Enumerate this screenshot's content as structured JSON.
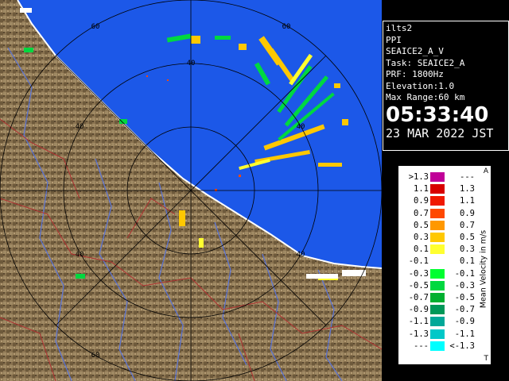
{
  "info": {
    "site": "ilts2",
    "mode": "PPI",
    "product": "SEAICE2_A_V",
    "task": "Task: SEAICE2_A",
    "prf": "PRF: 1800Hz",
    "elevation": "Elevation:1.0",
    "max_range": "Max Range:60 km",
    "time": "05:33:40",
    "date": "23 MAR 2022 JST"
  },
  "map": {
    "range_ring_labels": [
      "60",
      "40",
      "60",
      "40",
      "40",
      "40",
      "40",
      "60"
    ],
    "colors": {
      "sea": "#1c58e8",
      "land": "#8a7350",
      "ring": "#000000",
      "river": "#5a74d8",
      "border": "#b03030",
      "coast": "#ffffff"
    }
  },
  "legend": {
    "title": "Mean Velocity in m/s",
    "corner_top": "A",
    "corner_bottom": "T",
    "rows": [
      {
        "left": ">1.3",
        "right": "---",
        "color": "#c00098"
      },
      {
        "left": "1.1",
        "right": "1.3",
        "color": "#d80000"
      },
      {
        "left": "0.9",
        "right": "1.1",
        "color": "#f01800"
      },
      {
        "left": "0.7",
        "right": "0.9",
        "color": "#ff4800"
      },
      {
        "left": "0.5",
        "right": "0.7",
        "color": "#ff9800"
      },
      {
        "left": "0.3",
        "right": "0.5",
        "color": "#ffc800"
      },
      {
        "left": "0.1",
        "right": "0.3",
        "color": "#ffff30"
      },
      {
        "left": "-0.1",
        "right": "0.1",
        "color": "#ffffff"
      },
      {
        "left": "-0.3",
        "right": "-0.1",
        "color": "#00ff30"
      },
      {
        "left": "-0.5",
        "right": "-0.3",
        "color": "#00d840"
      },
      {
        "left": "-0.7",
        "right": "-0.5",
        "color": "#00b030"
      },
      {
        "left": "-0.9",
        "right": "-0.7",
        "color": "#009858"
      },
      {
        "left": "-1.1",
        "right": "-0.9",
        "color": "#00a898"
      },
      {
        "left": "-1.3",
        "right": "-1.1",
        "color": "#00c8c8"
      },
      {
        "left": "---",
        "right": "<-1.3",
        "color": "#00ffff"
      }
    ]
  }
}
